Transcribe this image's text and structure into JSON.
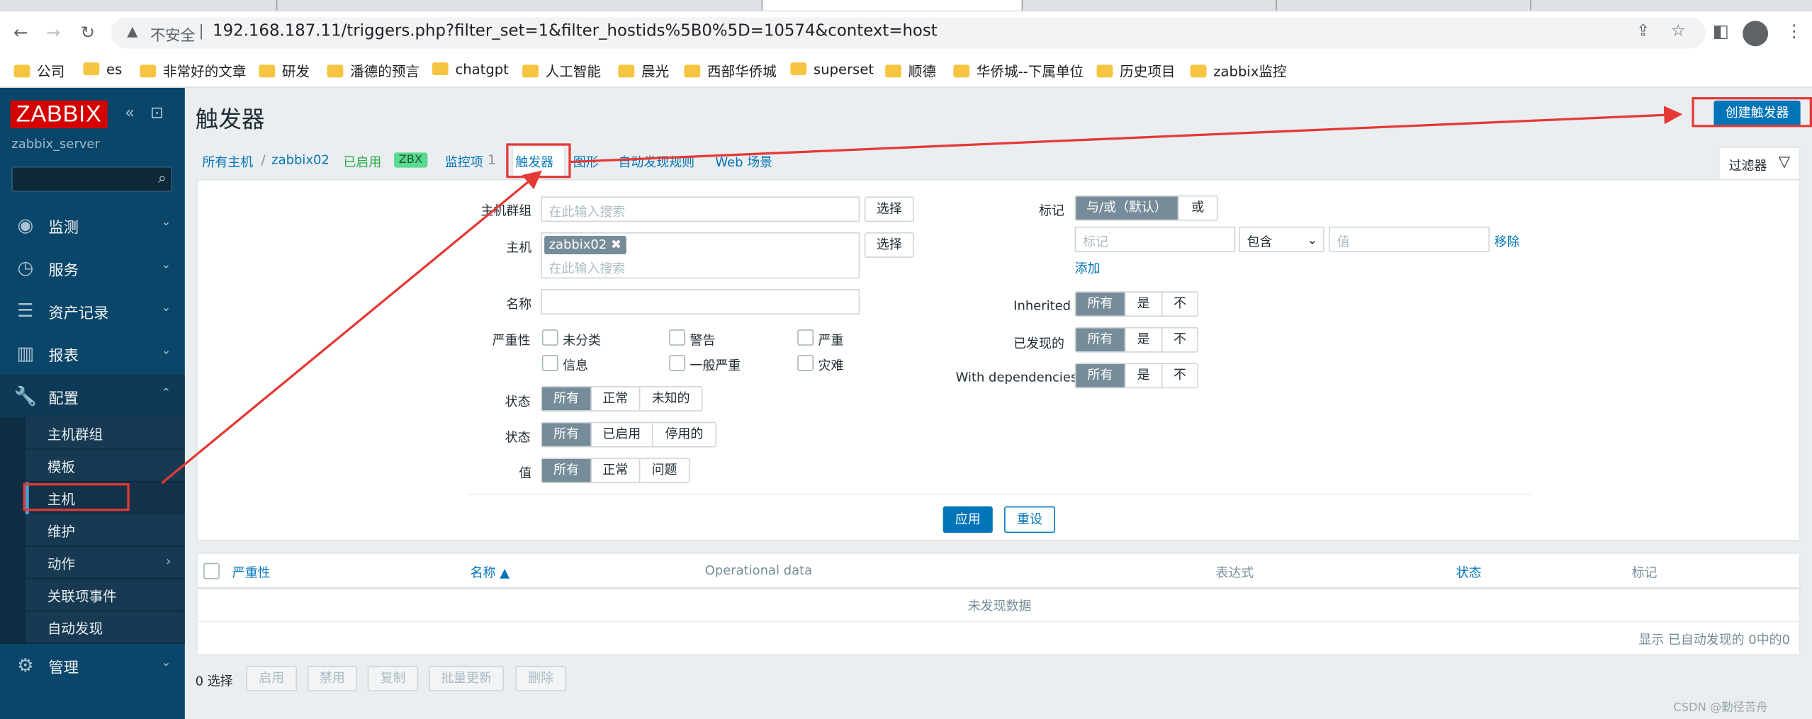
{
  "browser": {
    "address": {
      "security_label": "不安全",
      "url": "192.168.187.11/triggers.php?filter_set=1&filter_hostids%5B0%5D=10574&context=host"
    },
    "bookmarks": [
      "公司",
      "es",
      "非常好的文章",
      "研发",
      "潘德的预言",
      "chatgpt",
      "人工智能",
      "晨光",
      "西部华侨城",
      "superset",
      "顺德",
      "华侨城--下属单位",
      "历史项目",
      "zabbix监控"
    ]
  },
  "sidebar": {
    "logo": "ZABBIX",
    "server_name": "zabbix_server",
    "menu": [
      {
        "label": "监测",
        "icon": "eye-icon"
      },
      {
        "label": "服务",
        "icon": "stopwatch-icon"
      },
      {
        "label": "资产记录",
        "icon": "list-icon"
      },
      {
        "label": "报表",
        "icon": "bar-chart-icon"
      },
      {
        "label": "配置",
        "icon": "wrench-icon"
      },
      {
        "label": "管理",
        "icon": "gear-icon"
      }
    ],
    "config_submenu": [
      "主机群组",
      "模板",
      "主机",
      "维护",
      "动作",
      "关联项事件",
      "自动发现"
    ]
  },
  "header": {
    "title": "触发器",
    "create_button": "创建触发器"
  },
  "breadcrumb": {
    "all_hosts": "所有主机",
    "separator": "/",
    "host": "zabbix02",
    "enabled": "已启用",
    "zbx": "ZBX",
    "items_label": "监控项",
    "items_count": "1",
    "triggers": "触发器",
    "graphs": "图形",
    "discovery": "自动发现规则",
    "web": "Web 场景"
  },
  "filter": {
    "tab_label": "过滤器",
    "host_group": {
      "label": "主机群组",
      "placeholder": "在此输入搜索",
      "select": "选择"
    },
    "host": {
      "label": "主机",
      "chip": "zabbix02",
      "placeholder": "在此输入搜索",
      "select": "选择"
    },
    "name": {
      "label": "名称",
      "value": ""
    },
    "severity": {
      "label": "严重性",
      "options": [
        "未分类",
        "警告",
        "严重",
        "信息",
        "一般严重",
        "灾难"
      ]
    },
    "state": {
      "label": "状态",
      "options": [
        "所有",
        "正常",
        "未知的"
      ],
      "selected": "所有"
    },
    "status": {
      "label": "状态",
      "options": [
        "所有",
        "已启用",
        "停用的"
      ],
      "selected": "所有"
    },
    "value": {
      "label": "值",
      "options": [
        "所有",
        "正常",
        "问题"
      ],
      "selected": "所有"
    },
    "tags": {
      "label": "标记",
      "operator_options": [
        "与/或（默认）",
        "或"
      ],
      "operator_selected": "与/或（默认）",
      "tag_placeholder": "标记",
      "condition": "包含",
      "value_placeholder": "值",
      "remove": "移除",
      "add": "添加"
    },
    "inherited": {
      "label": "Inherited",
      "options": [
        "所有",
        "是",
        "不"
      ],
      "selected": "所有"
    },
    "discovered": {
      "label": "已发现的",
      "options": [
        "所有",
        "是",
        "不"
      ],
      "selected": "所有"
    },
    "dependencies": {
      "label": "With dependencies",
      "options": [
        "所有",
        "是",
        "不"
      ],
      "selected": "所有"
    },
    "apply": "应用",
    "reset": "重设"
  },
  "table": {
    "columns": [
      "严重性",
      "名称 ▲",
      "Operational data",
      "表达式",
      "状态",
      "标记"
    ],
    "empty_message": "未发现数据",
    "footer": "显示 已自动发现的 0中的0"
  },
  "mass_actions": {
    "selected": "0 选择",
    "buttons": [
      "启用",
      "禁用",
      "复制",
      "批量更新",
      "删除"
    ]
  },
  "watermark": "CSDN @勤径苦舟",
  "colors": {
    "sidebar": "#0a466a",
    "accent": "#0275b8",
    "logo": "#d40000",
    "annotation": "#e53935"
  }
}
